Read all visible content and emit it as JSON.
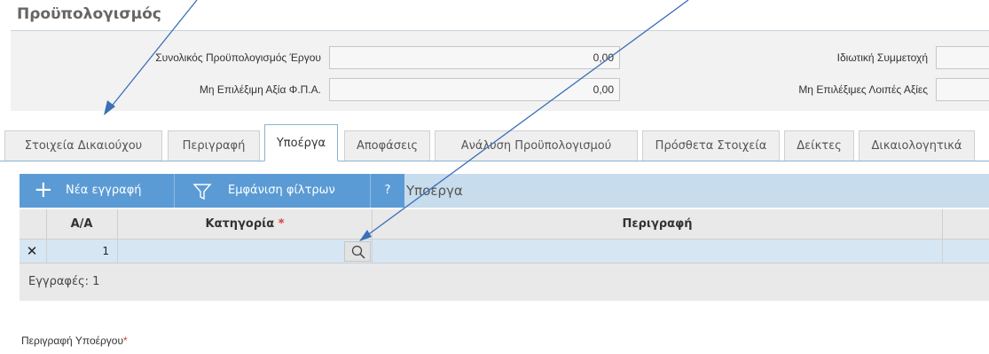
{
  "header": {
    "title": "Προϋπολογισμός"
  },
  "form": {
    "left": [
      {
        "label": "Συνολικός Προϋπολογισμός Έργου",
        "value": "0,00"
      },
      {
        "label": "Μη Επιλέξιμη Αξία Φ.Π.Α.",
        "value": "0,00"
      }
    ],
    "right": [
      {
        "label": "Ιδιωτική Συμμετοχή",
        "value": ""
      },
      {
        "label": "Μη Επιλέξιμες Λοιπές Αξίες",
        "value": ""
      }
    ]
  },
  "tabs": [
    {
      "label": "Στοιχεία Δικαιούχου"
    },
    {
      "label": "Περιγραφή"
    },
    {
      "label": "Υποέργα",
      "active": true
    },
    {
      "label": "Αποφάσεις"
    },
    {
      "label": "Ανάλυση Προϋπολογισμού"
    },
    {
      "label": "Πρόσθετα Στοιχεία"
    },
    {
      "label": "Δείκτες"
    },
    {
      "label": "Δικαιολογητικά"
    }
  ],
  "grid": {
    "new_label": "Νέα εγγραφή",
    "filters_label": "Εμφάνιση φίλτρων",
    "help_label": "?",
    "title": "Υποέργα",
    "columns": {
      "aa": "Α/Α",
      "category": "Κατηγορία",
      "description": "Περιγραφή"
    },
    "required_mark": "*",
    "rows": [
      {
        "aa": "1",
        "category": "",
        "description": ""
      }
    ],
    "footer": "Εγγραφές: 1"
  },
  "subproject_description_label": "Περιγραφή Υποέργου",
  "colors": {
    "accent": "#5b9bd5",
    "arrow": "#3b6fb6",
    "required": "#e03b3b"
  }
}
